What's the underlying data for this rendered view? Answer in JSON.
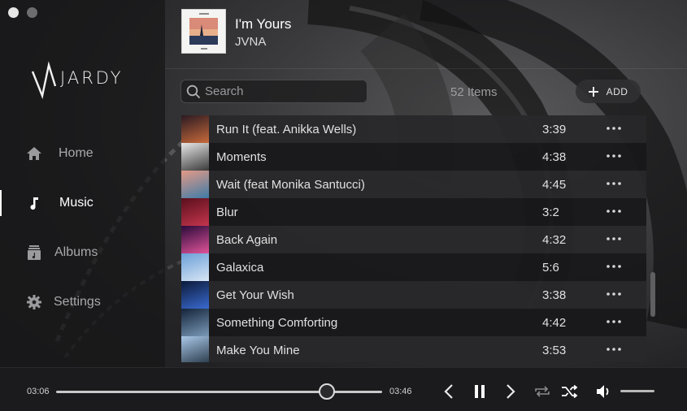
{
  "window": {
    "traffic_colors": [
      "#e6e6e6",
      "#6d6d6f"
    ]
  },
  "brand": {
    "name": "JARDY"
  },
  "nav": [
    {
      "id": "home",
      "label": "Home",
      "icon": "home-icon",
      "active": false
    },
    {
      "id": "music",
      "label": "Music",
      "icon": "music-note-icon",
      "active": true
    },
    {
      "id": "albums",
      "label": "Albums",
      "icon": "album-icon",
      "active": false
    },
    {
      "id": "settings",
      "label": "Settings",
      "icon": "gear-icon",
      "active": false
    }
  ],
  "now_playing": {
    "title": "I'm Yours",
    "artist": "JVNA"
  },
  "search": {
    "placeholder": "Search",
    "value": ""
  },
  "library": {
    "items_label": "52 Items",
    "add_label": "ADD"
  },
  "tracks": [
    {
      "title": "Run It (feat. Anikka Wells)",
      "duration": "3:39",
      "art_colors": [
        "#2b1a22",
        "#c86a3a"
      ]
    },
    {
      "title": "Moments",
      "duration": "4:38",
      "art_colors": [
        "#e8e8e8",
        "#3a3a3a"
      ]
    },
    {
      "title": "Wait (feat Monika Santucci)",
      "duration": "4:45",
      "art_colors": [
        "#e49a86",
        "#3e7ca8"
      ]
    },
    {
      "title": "Blur",
      "duration": "3:2",
      "art_colors": [
        "#5a0f1c",
        "#c5354d"
      ]
    },
    {
      "title": "Back Again",
      "duration": "4:32",
      "art_colors": [
        "#2a0a3a",
        "#e0549a"
      ]
    },
    {
      "title": "Galaxica",
      "duration": "5:6",
      "art_colors": [
        "#6b9fd8",
        "#d8e6f4"
      ]
    },
    {
      "title": "Get Your Wish",
      "duration": "3:38",
      "art_colors": [
        "#0b1a38",
        "#3a6ad0"
      ]
    },
    {
      "title": "Something Comforting",
      "duration": "4:42",
      "art_colors": [
        "#14243a",
        "#7a9ab8"
      ]
    },
    {
      "title": "Make You Mine",
      "duration": "3:53",
      "art_colors": [
        "#a9c8e8",
        "#2a3a4a"
      ]
    }
  ],
  "player": {
    "current_time": "03:06",
    "total_time": "03:46",
    "progress": 0.83,
    "volume": 0.0
  }
}
